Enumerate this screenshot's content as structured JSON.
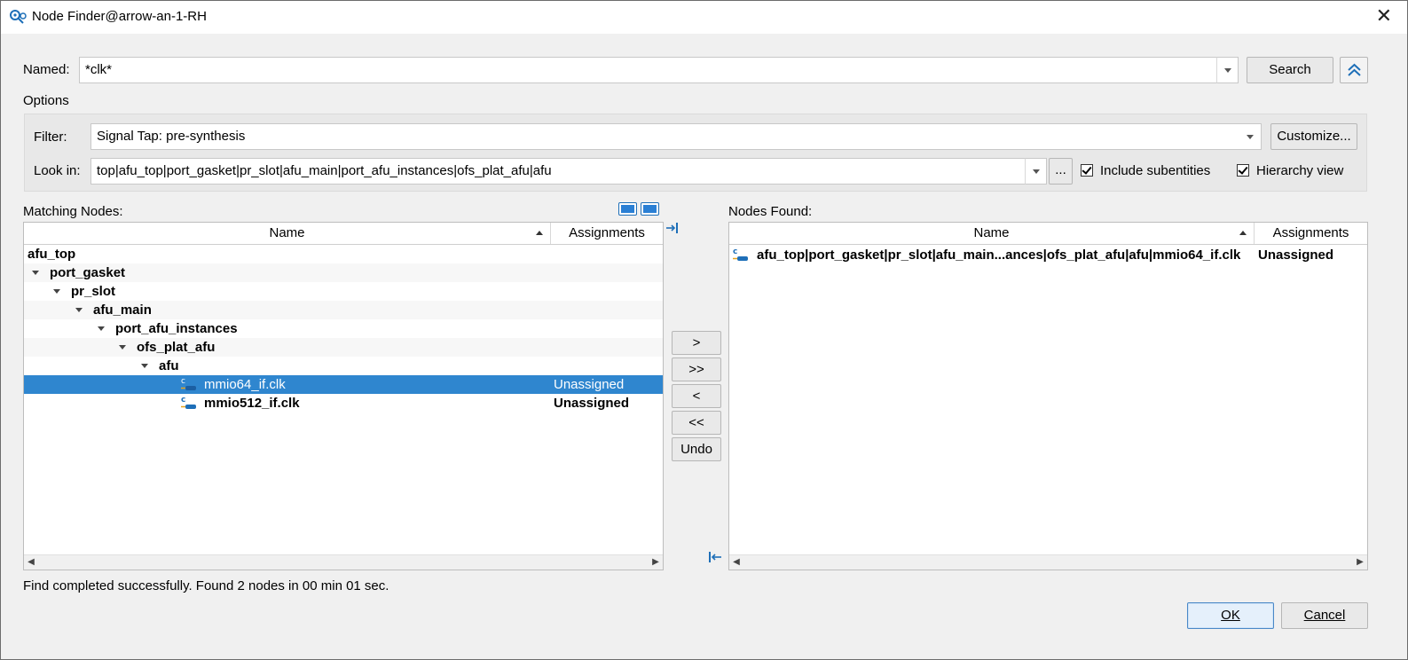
{
  "window": {
    "title": "Node Finder@arrow-an-1-RH",
    "close_glyph": "✕"
  },
  "named": {
    "label": "Named:",
    "value": "*clk*",
    "search_label": "Search"
  },
  "options": {
    "label": "Options",
    "filter_label": "Filter:",
    "filter_value": "Signal Tap: pre-synthesis",
    "customize_label": "Customize...",
    "lookin_label": "Look in:",
    "lookin_value": "top|afu_top|port_gasket|pr_slot|afu_main|port_afu_instances|ofs_plat_afu|afu",
    "browse_label": "...",
    "include_subentities_label": "Include subentities",
    "include_subentities_checked": true,
    "hierarchy_view_label": "Hierarchy view",
    "hierarchy_view_checked": true
  },
  "matching": {
    "label": "Matching Nodes:",
    "columns": {
      "name": "Name",
      "assignments": "Assignments"
    },
    "rows": [
      {
        "name": "afu_top",
        "assignment": ""
      },
      {
        "name": "port_gasket",
        "assignment": ""
      },
      {
        "name": "pr_slot",
        "assignment": ""
      },
      {
        "name": "afu_main",
        "assignment": ""
      },
      {
        "name": "port_afu_instances",
        "assignment": ""
      },
      {
        "name": "ofs_plat_afu",
        "assignment": ""
      },
      {
        "name": "afu",
        "assignment": ""
      },
      {
        "name": "mmio64_if.clk",
        "assignment": "Unassigned"
      },
      {
        "name": "mmio512_if.clk",
        "assignment": "Unassigned"
      }
    ]
  },
  "transfer": {
    "add": ">",
    "add_all": ">>",
    "remove": "<",
    "remove_all": "<<",
    "undo": "Undo"
  },
  "found": {
    "label": "Nodes Found:",
    "columns": {
      "name": "Name",
      "assignments": "Assignments"
    },
    "rows": [
      {
        "name": "afu_top|port_gasket|pr_slot|afu_main...ances|ofs_plat_afu|afu|mmio64_if.clk",
        "assignment": "Unassigned"
      }
    ]
  },
  "status": "Find completed successfully. Found 2 nodes in 00 min 01 sec.",
  "footer": {
    "ok": "OK",
    "cancel": "Cancel"
  },
  "colors": {
    "selection": "#2f86cf",
    "accent": "#1e6fb8"
  }
}
